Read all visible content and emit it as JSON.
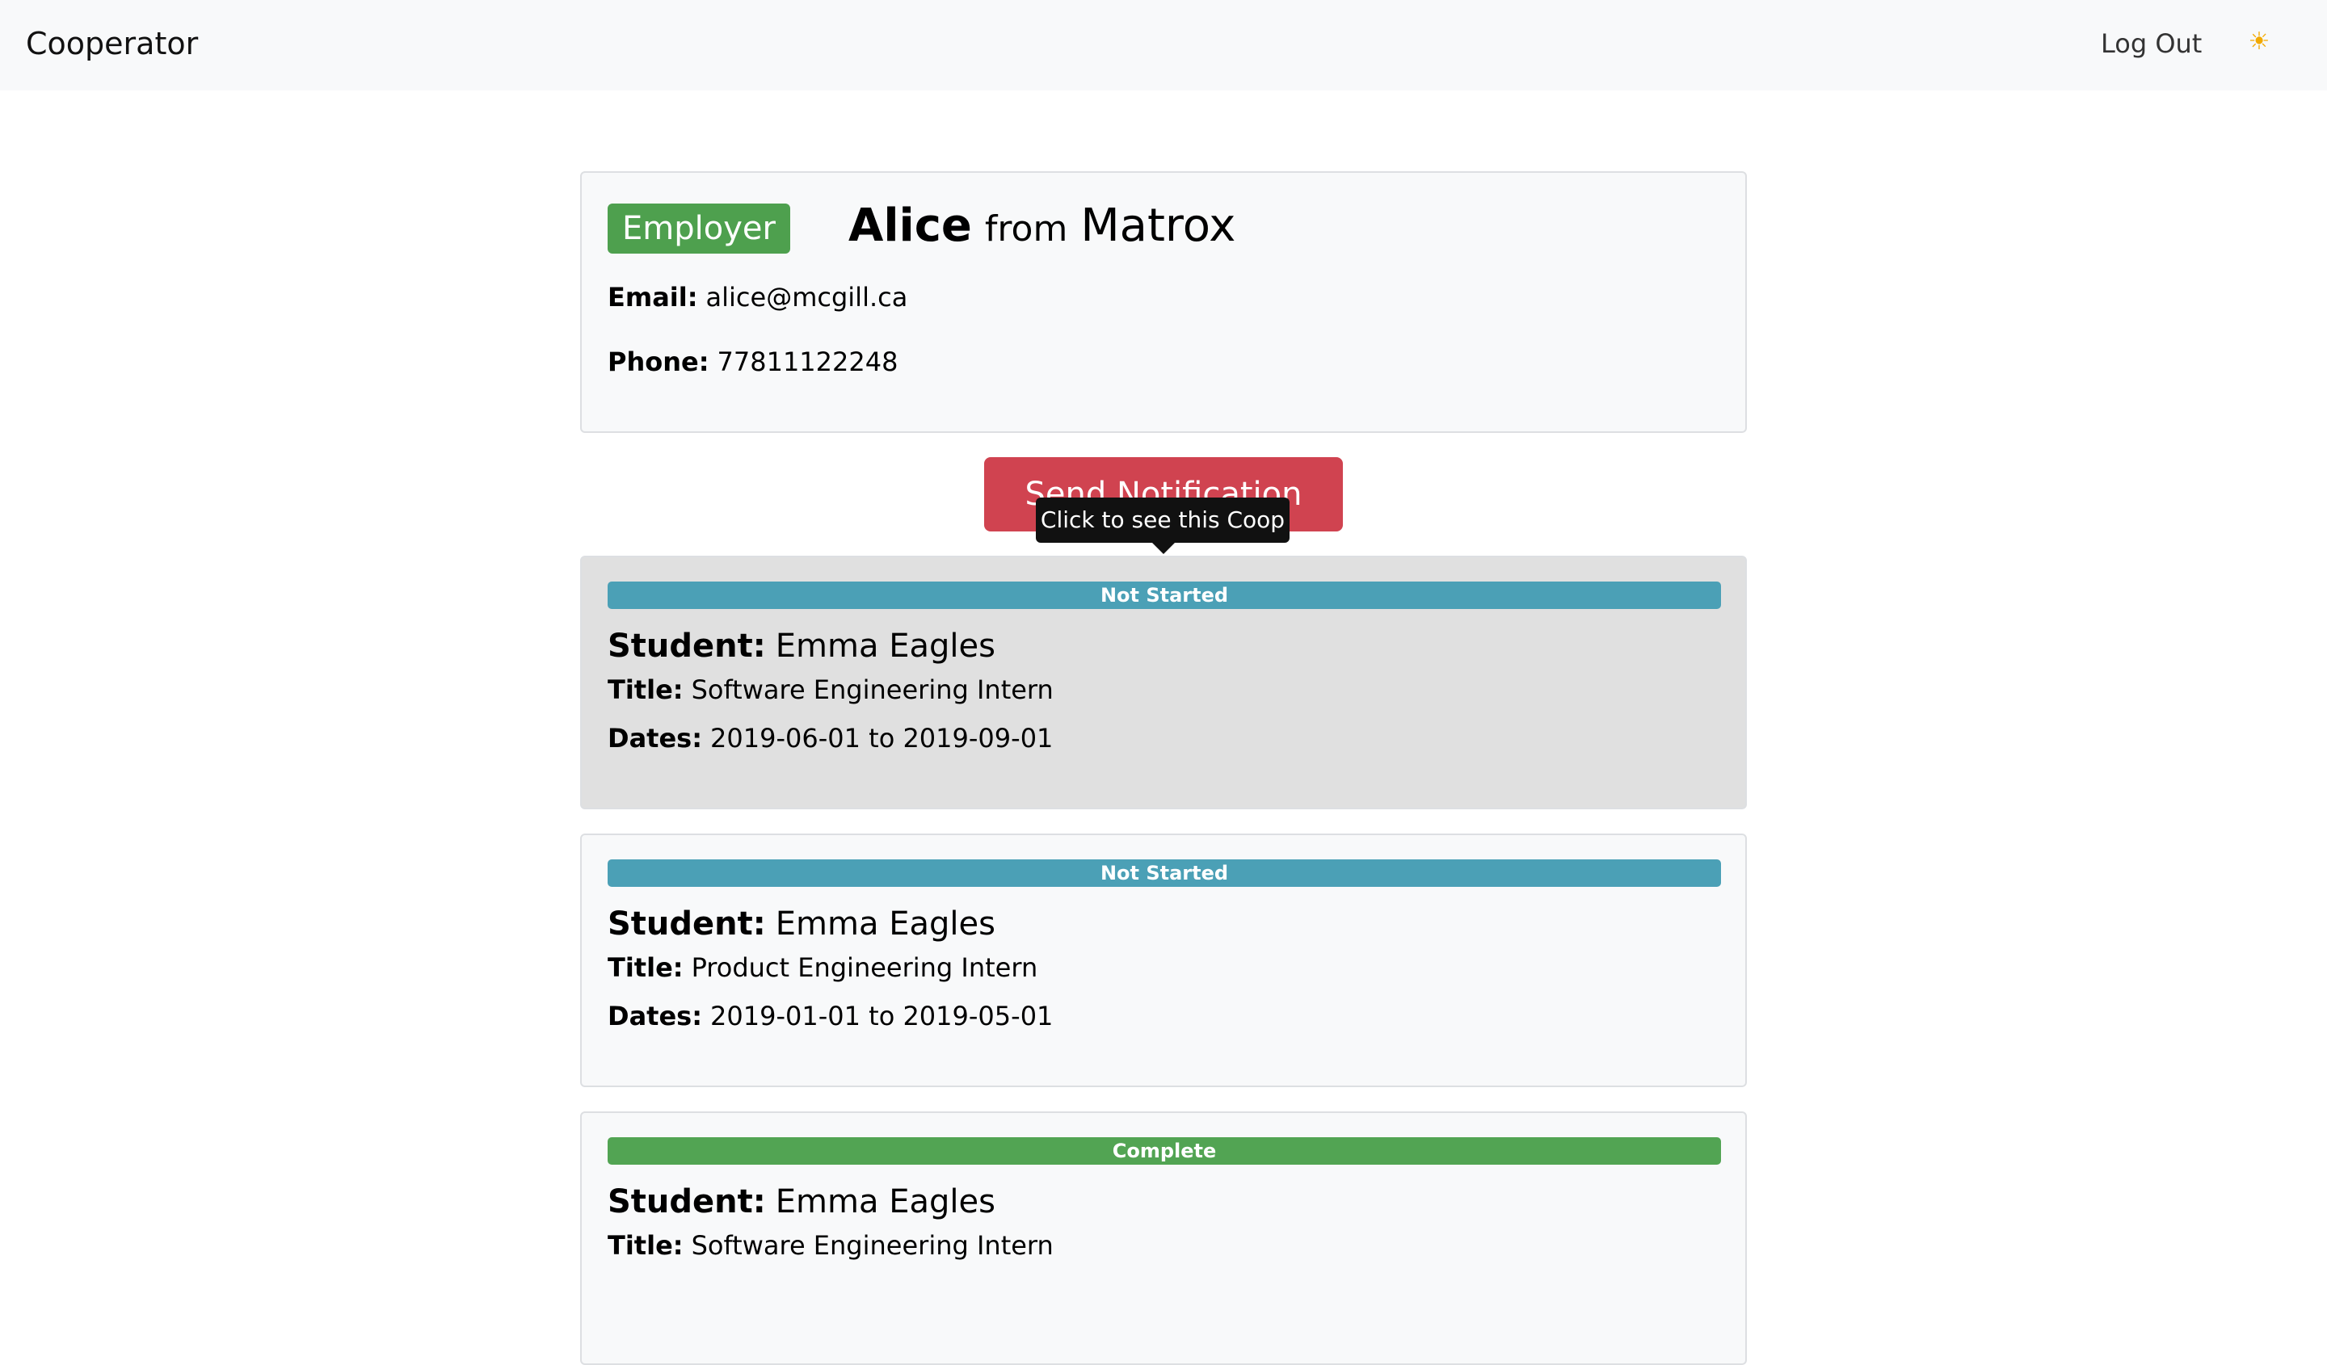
{
  "navbar": {
    "brand": "Cooperator",
    "logout_label": "Log Out",
    "theme_icon": "☀"
  },
  "profile": {
    "role_badge": "Employer",
    "name": "Alice",
    "from_word": "from",
    "company": "Matrox",
    "email_label": "Email:",
    "email": "alice@mcgill.ca",
    "phone_label": "Phone:",
    "phone": "77811122248"
  },
  "actions": {
    "send_notification_label": "Send Notification"
  },
  "tooltip": {
    "text": "Click to see this Coop"
  },
  "colors": {
    "not_started": "#4ba0b6",
    "complete": "#52a453",
    "send_button": "#d04350",
    "employer_badge": "#4ea04e"
  },
  "labels": {
    "student": "Student:",
    "title": "Title:",
    "dates": "Dates:"
  },
  "coops": [
    {
      "status": "Not Started",
      "status_color": "#4ba0b6",
      "student": "Emma Eagles",
      "title": "Software Engineering Intern",
      "dates": "2019-06-01 to 2019-09-01"
    },
    {
      "status": "Not Started",
      "status_color": "#4ba0b6",
      "student": "Emma Eagles",
      "title": "Product Engineering Intern",
      "dates": "2019-01-01 to 2019-05-01"
    },
    {
      "status": "Complete",
      "status_color": "#52a453",
      "student": "Emma Eagles",
      "title": "Software Engineering Intern",
      "dates": ""
    }
  ]
}
